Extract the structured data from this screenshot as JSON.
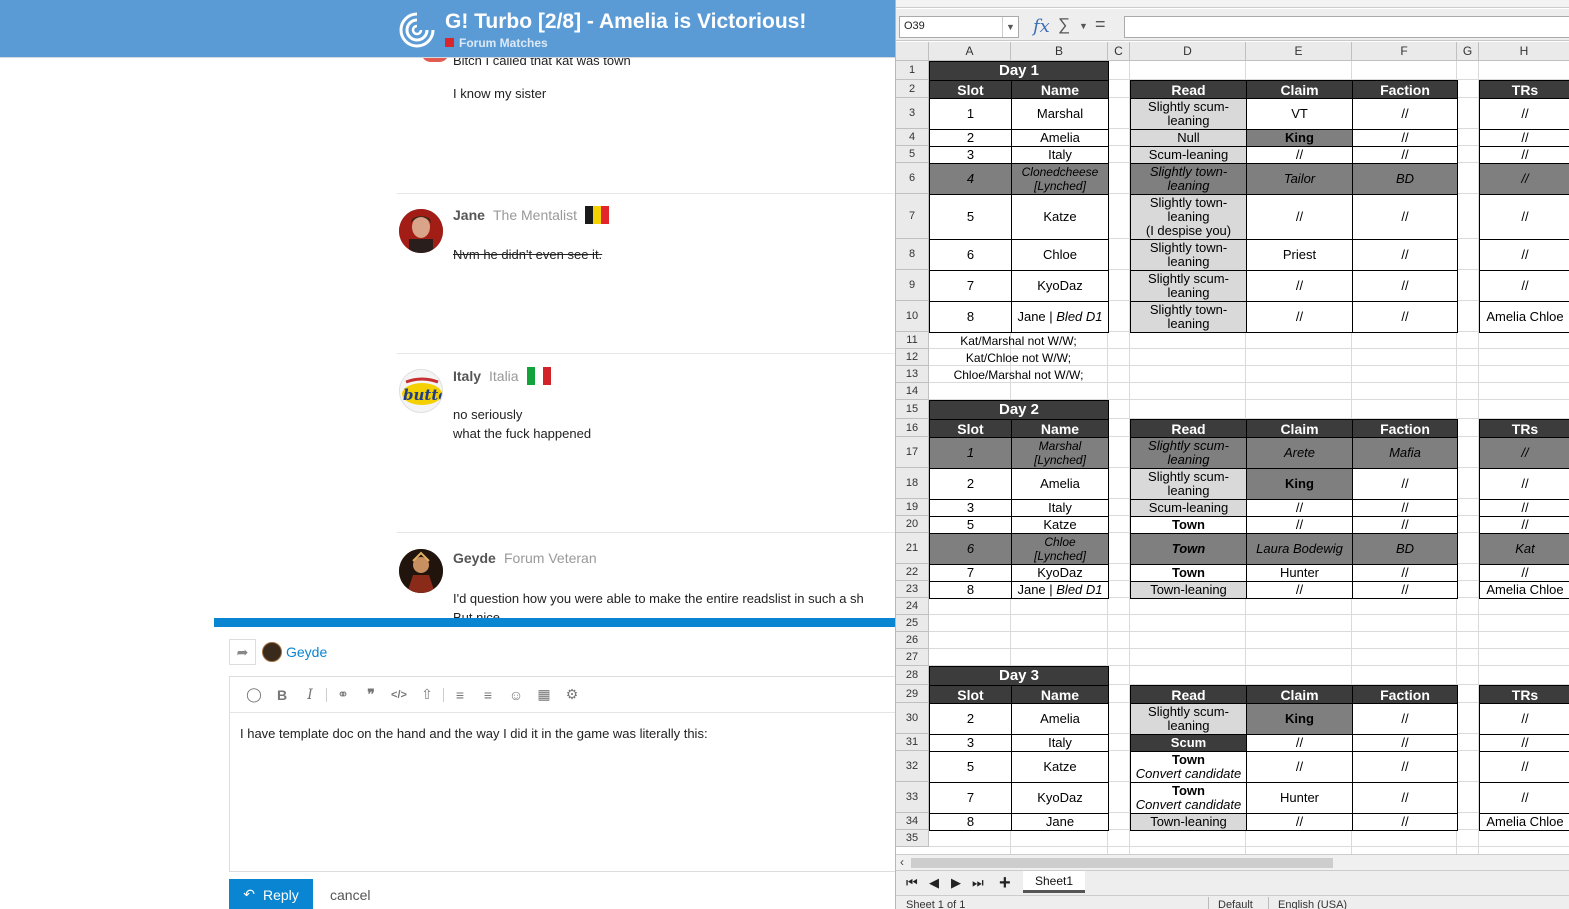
{
  "forum": {
    "title": "G! Turbo [2/8] - Amelia is Victorious!",
    "category": "Forum Matches",
    "top_post_lines": [
      "Bitch I called that kat was town",
      "I know my sister"
    ],
    "posts": [
      {
        "user": "Jane",
        "title": "The Mentalist",
        "lines": [
          "Nvm he didn't even see it."
        ],
        "flag_colors": [
          "#1a1a1a",
          "#f4d100",
          "#e3242b"
        ]
      },
      {
        "user": "Italy",
        "title": "Italia",
        "lines": [
          "no seriously",
          "what the fuck happened"
        ],
        "flag_colors": [
          "#13a23b",
          "#ffffff",
          "#d2232a"
        ]
      },
      {
        "user": "Geyde",
        "title": "Forum Veteran",
        "lines": [
          "I'd question how you were able to make the entire readslist in such a sh",
          "But nice"
        ]
      }
    ],
    "italy_avatar_text": "butte",
    "composer": {
      "reply_to": "Geyde",
      "text": "I have template doc on the hand and the way I did it in the game was literally this:",
      "reply_label": "Reply",
      "cancel_label": "cancel"
    }
  },
  "calc": {
    "name_box": "O39",
    "fx_label": "fx",
    "columns": [
      "A",
      "B",
      "C",
      "D",
      "E",
      "F",
      "G",
      "H"
    ],
    "rows": [
      "1",
      "2",
      "3",
      "4",
      "5",
      "6",
      "7",
      "8",
      "9",
      "10",
      "11",
      "12",
      "13",
      "14",
      "15",
      "16",
      "17",
      "18",
      "19",
      "20",
      "21",
      "22",
      "23",
      "24",
      "25",
      "26",
      "27",
      "28",
      "29",
      "30",
      "31",
      "32",
      "33",
      "34",
      "35"
    ],
    "day1": {
      "title": "Day 1",
      "headers": [
        "Slot",
        "Name",
        "Read",
        "Claim",
        "Faction",
        "TRs"
      ],
      "rows": [
        {
          "slot": "1",
          "name": "Marshal",
          "name_note": "",
          "read": "Slightly scum-leaning",
          "read_note": "",
          "claim": "VT",
          "faction": "//",
          "trs": "//"
        },
        {
          "slot": "2",
          "name": "Amelia",
          "name_note": "",
          "read": "Null",
          "read_note": "",
          "claim": "King",
          "faction": "//",
          "trs": "//"
        },
        {
          "slot": "3",
          "name": "Italy",
          "name_note": "",
          "read": "Scum-leaning",
          "read_note": "",
          "claim": "//",
          "faction": "//",
          "trs": "//"
        },
        {
          "slot": "4",
          "name": "Clonedcheese",
          "name_note": "[Lynched]",
          "read": "Slightly town-leaning",
          "read_note": "",
          "claim": "Tailor",
          "faction": "BD",
          "trs": "//"
        },
        {
          "slot": "5",
          "name": "Katze",
          "name_note": "",
          "read": "Slightly town-leaning",
          "read_note": "(I despise you)",
          "claim": "//",
          "faction": "//",
          "trs": "//"
        },
        {
          "slot": "6",
          "name": "Chloe",
          "name_note": "",
          "read": "Slightly town-leaning",
          "read_note": "",
          "claim": "Priest",
          "faction": "//",
          "trs": "//"
        },
        {
          "slot": "7",
          "name": "KyoDaz",
          "name_note": "",
          "read": "Slightly scum-leaning",
          "read_note": "",
          "claim": "//",
          "faction": "//",
          "trs": "//"
        },
        {
          "slot": "8",
          "name": "Jane | ",
          "name_note": "Bled D1",
          "read": "Slightly town-leaning",
          "read_note": "",
          "claim": "//",
          "faction": "//",
          "trs": "Amelia Chloe"
        }
      ],
      "notes": [
        "Kat/Marshal not W/W;",
        "Kat/Chloe not W/W;",
        "Chloe/Marshal not W/W;"
      ]
    },
    "day2": {
      "title": "Day 2",
      "headers": [
        "Slot",
        "Name",
        "Read",
        "Claim",
        "Faction",
        "TRs"
      ],
      "rows": [
        {
          "slot": "1",
          "name": "Marshal",
          "name_note": "[Lynched]",
          "read": "Slightly scum-leaning",
          "read_note": "",
          "claim": "Arete",
          "faction": "Mafia",
          "trs": "//"
        },
        {
          "slot": "2",
          "name": "Amelia",
          "name_note": "",
          "read": "Slightly scum-leaning",
          "read_note": "",
          "claim": "King",
          "faction": "//",
          "trs": "//"
        },
        {
          "slot": "3",
          "name": "Italy",
          "name_note": "",
          "read": "Scum-leaning",
          "read_note": "",
          "claim": "//",
          "faction": "//",
          "trs": "//"
        },
        {
          "slot": "5",
          "name": "Katze",
          "name_note": "",
          "read": "Town",
          "read_note": "",
          "claim": "//",
          "faction": "//",
          "trs": "//"
        },
        {
          "slot": "6",
          "name": "Chloe",
          "name_note": "[Lynched]",
          "read": "Town",
          "read_note": "",
          "claim": "Laura Bodewig",
          "faction": "BD",
          "trs": "Kat"
        },
        {
          "slot": "7",
          "name": "KyoDaz",
          "name_note": "",
          "read": "Town",
          "read_note": "",
          "claim": "Hunter",
          "faction": "//",
          "trs": "//"
        },
        {
          "slot": "8",
          "name": "Jane | ",
          "name_note": "Bled D1",
          "read": "Town-leaning",
          "read_note": "",
          "claim": "//",
          "faction": "//",
          "trs": "Amelia Chloe"
        }
      ]
    },
    "day3": {
      "title": "Day 3",
      "headers": [
        "Slot",
        "Name",
        "Read",
        "Claim",
        "Faction",
        "TRs"
      ],
      "rows": [
        {
          "slot": "2",
          "name": "Amelia",
          "name_note": "",
          "read": "Slightly scum-leaning",
          "read_note": "",
          "claim": "King",
          "faction": "//",
          "trs": "//"
        },
        {
          "slot": "3",
          "name": "Italy",
          "name_note": "",
          "read": "Scum",
          "read_note": "",
          "claim": "//",
          "faction": "//",
          "trs": "//"
        },
        {
          "slot": "5",
          "name": "Katze",
          "name_note": "",
          "read": "Town",
          "read_note": "Convert candidate",
          "claim": "//",
          "faction": "//",
          "trs": "//"
        },
        {
          "slot": "7",
          "name": "KyoDaz",
          "name_note": "",
          "read": "Town",
          "read_note": "Convert candidate",
          "claim": "Hunter",
          "faction": "//",
          "trs": "//"
        },
        {
          "slot": "8",
          "name": "Jane",
          "name_note": "",
          "read": "Town-leaning",
          "read_note": "",
          "claim": "//",
          "faction": "//",
          "trs": "Amelia Chloe"
        }
      ]
    },
    "sheet_tab": "Sheet1",
    "status": {
      "sheet_count": "Sheet 1 of 1",
      "page_style": "Default",
      "language": "English (USA)"
    },
    "colors": {
      "header_dark": "#3c3c3c",
      "lynched_fill": "#7f7f7f",
      "read_fill": "#d9d9d9",
      "scum_fill": "#3c3c3c"
    }
  }
}
